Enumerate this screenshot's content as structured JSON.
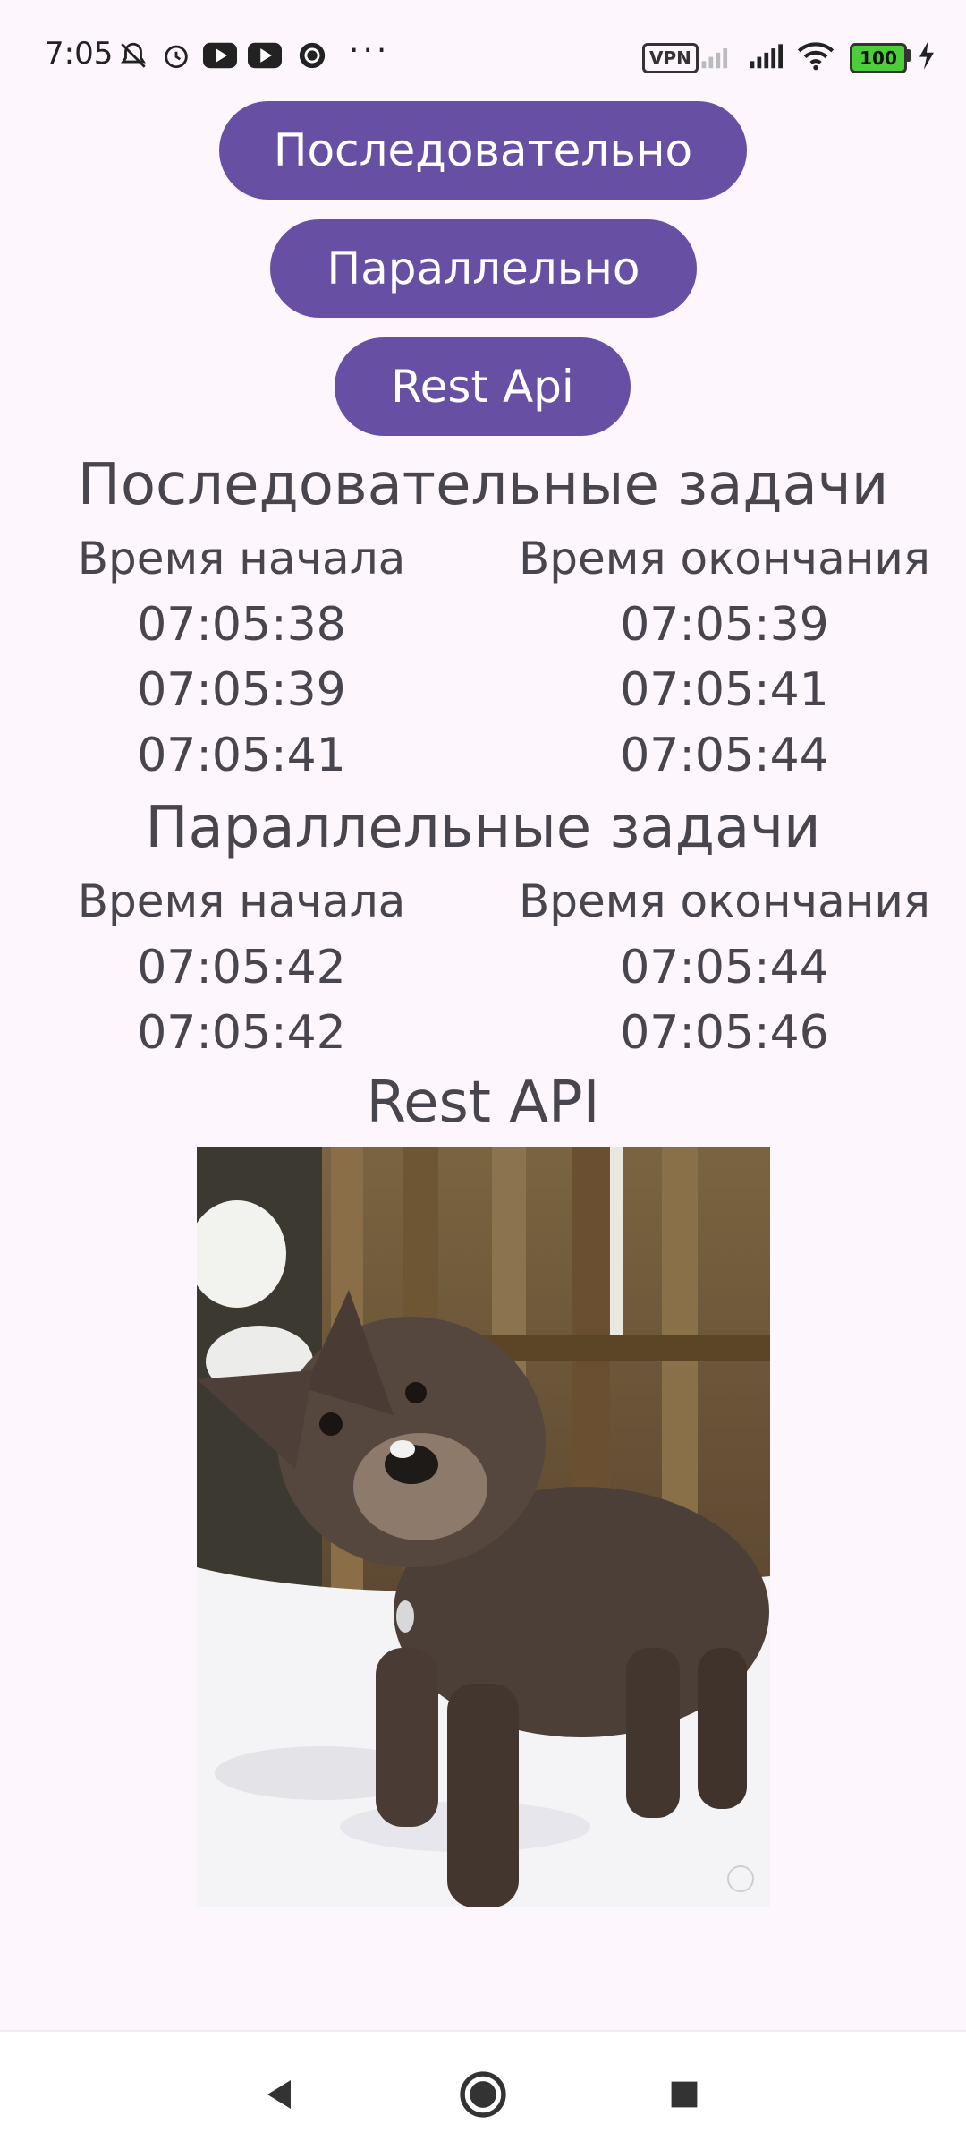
{
  "status_bar": {
    "time": "7:05",
    "icons": [
      "notifications-off-icon",
      "alarm-icon",
      "youtube-icon",
      "youtube-icon",
      "vpn-app-icon"
    ],
    "more": "···",
    "vpn": "VPN",
    "battery": "100"
  },
  "buttons": {
    "sequential": "Последовательно",
    "parallel": "Параллельно",
    "rest_api": "Rest Api"
  },
  "sequential": {
    "title": "Последовательные задачи",
    "start_header": "Время начала",
    "end_header": "Время окончания",
    "rows": [
      {
        "start": "07:05:38",
        "end": "07:05:39"
      },
      {
        "start": "07:05:39",
        "end": "07:05:41"
      },
      {
        "start": "07:05:41",
        "end": "07:05:44"
      }
    ]
  },
  "parallel": {
    "title": "Параллельные задачи",
    "start_header": "Время начала",
    "end_header": "Время окончания",
    "rows": [
      {
        "start": "07:05:42",
        "end": "07:05:44"
      },
      {
        "start": "07:05:42",
        "end": "07:05:46"
      }
    ]
  },
  "rest": {
    "title": "Rest API"
  },
  "colors": {
    "accent": "#6750a4",
    "background": "#fdf7fd",
    "text": "#49454f"
  }
}
